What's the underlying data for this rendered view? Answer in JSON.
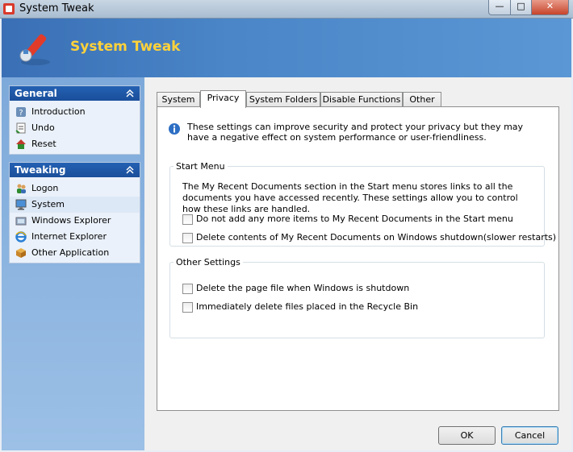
{
  "window": {
    "title": "System Tweak",
    "controls": {
      "minimize": "—",
      "maximize": "□",
      "close": "✕"
    }
  },
  "header": {
    "app_name": "System Tweak",
    "logo_icon": "wrench-icon"
  },
  "sidebar": {
    "groups": [
      {
        "title": "General",
        "collapse_icon": "double-chevron-up-icon",
        "items": [
          {
            "label": "Introduction",
            "icon": "help-icon"
          },
          {
            "label": "Undo",
            "icon": "undo-icon"
          },
          {
            "label": "Reset",
            "icon": "reset-icon"
          }
        ]
      },
      {
        "title": "Tweaking",
        "collapse_icon": "double-chevron-up-icon",
        "items": [
          {
            "label": "Logon",
            "icon": "users-icon"
          },
          {
            "label": "System",
            "icon": "computer-icon",
            "selected": true
          },
          {
            "label": "Windows Explorer",
            "icon": "folder-icon"
          },
          {
            "label": "Internet Explorer",
            "icon": "ie-icon"
          },
          {
            "label": "Other Application",
            "icon": "package-icon"
          }
        ]
      }
    ]
  },
  "tabs": [
    {
      "label": "System"
    },
    {
      "label": "Privacy",
      "active": true
    },
    {
      "label": "System Folders"
    },
    {
      "label": "Disable Functions"
    },
    {
      "label": "Other"
    }
  ],
  "privacy": {
    "info_text": "These settings can improve security and protect your privacy but they may have a negative effect on system performance or user-friendliness.",
    "start_menu": {
      "legend": "Start Menu",
      "description": "The My Recent Documents section in the Start menu stores links to all the documents you have accessed recently. These settings allow you to control how these links are handled.",
      "options": [
        {
          "label": "Do not add any more items to My Recent Documents in the Start menu",
          "checked": false
        },
        {
          "label": "Delete contents of My Recent Documents on Windows shutdown(slower restarts)",
          "checked": false
        }
      ]
    },
    "other_settings": {
      "legend": "Other Settings",
      "options": [
        {
          "label": "Delete the page file when Windows is shutdown",
          "checked": false
        },
        {
          "label": "Immediately delete files placed in the Recycle Bin",
          "checked": false
        }
      ]
    }
  },
  "buttons": {
    "ok": "OK",
    "cancel": "Cancel"
  }
}
